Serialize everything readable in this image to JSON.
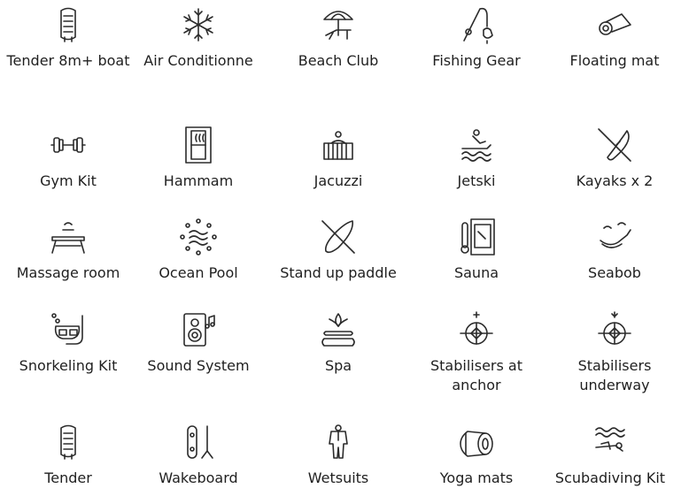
{
  "amenities": [
    {
      "label": "Tender 8m+ boat",
      "icon": "inflatable-boat-icon"
    },
    {
      "label": "Air Conditionne",
      "icon": "snowflake-icon"
    },
    {
      "label": "Beach Club",
      "icon": "beach-umbrella-icon"
    },
    {
      "label": "Fishing Gear",
      "icon": "fishing-rod-icon"
    },
    {
      "label": "Floating mat",
      "icon": "floating-mat-icon"
    },
    {
      "label": "Gym Kit",
      "icon": "dumbbell-icon"
    },
    {
      "label": "Hammam",
      "icon": "hammam-door-icon"
    },
    {
      "label": "Jacuzzi",
      "icon": "jacuzzi-icon"
    },
    {
      "label": "Jetski",
      "icon": "jetski-icon"
    },
    {
      "label": "Kayaks x 2",
      "icon": "kayak-icon"
    },
    {
      "label": "Massage room",
      "icon": "massage-table-icon"
    },
    {
      "label": "Ocean Pool",
      "icon": "ocean-pool-icon"
    },
    {
      "label": "Stand up paddle",
      "icon": "paddle-board-icon"
    },
    {
      "label": "Sauna",
      "icon": "sauna-icon"
    },
    {
      "label": "Seabob",
      "icon": "seabob-icon"
    },
    {
      "label": "Snorkeling Kit",
      "icon": "snorkel-mask-icon"
    },
    {
      "label": "Sound System",
      "icon": "speaker-icon"
    },
    {
      "label": "Spa",
      "icon": "spa-lotus-icon"
    },
    {
      "label": "Stabilisers at anchor",
      "icon": "stabiliser-anchor-icon"
    },
    {
      "label": "Stabilisers underway",
      "icon": "stabiliser-underway-icon"
    },
    {
      "label": "Tender",
      "icon": "inflatable-boat-icon"
    },
    {
      "label": "Wakeboard",
      "icon": "wakeboard-icon"
    },
    {
      "label": "Wetsuits",
      "icon": "wetsuit-icon"
    },
    {
      "label": "Yoga mats",
      "icon": "yoga-mat-roll-icon"
    },
    {
      "label": "Scubadiving Kit",
      "icon": "scuba-diver-icon"
    }
  ]
}
